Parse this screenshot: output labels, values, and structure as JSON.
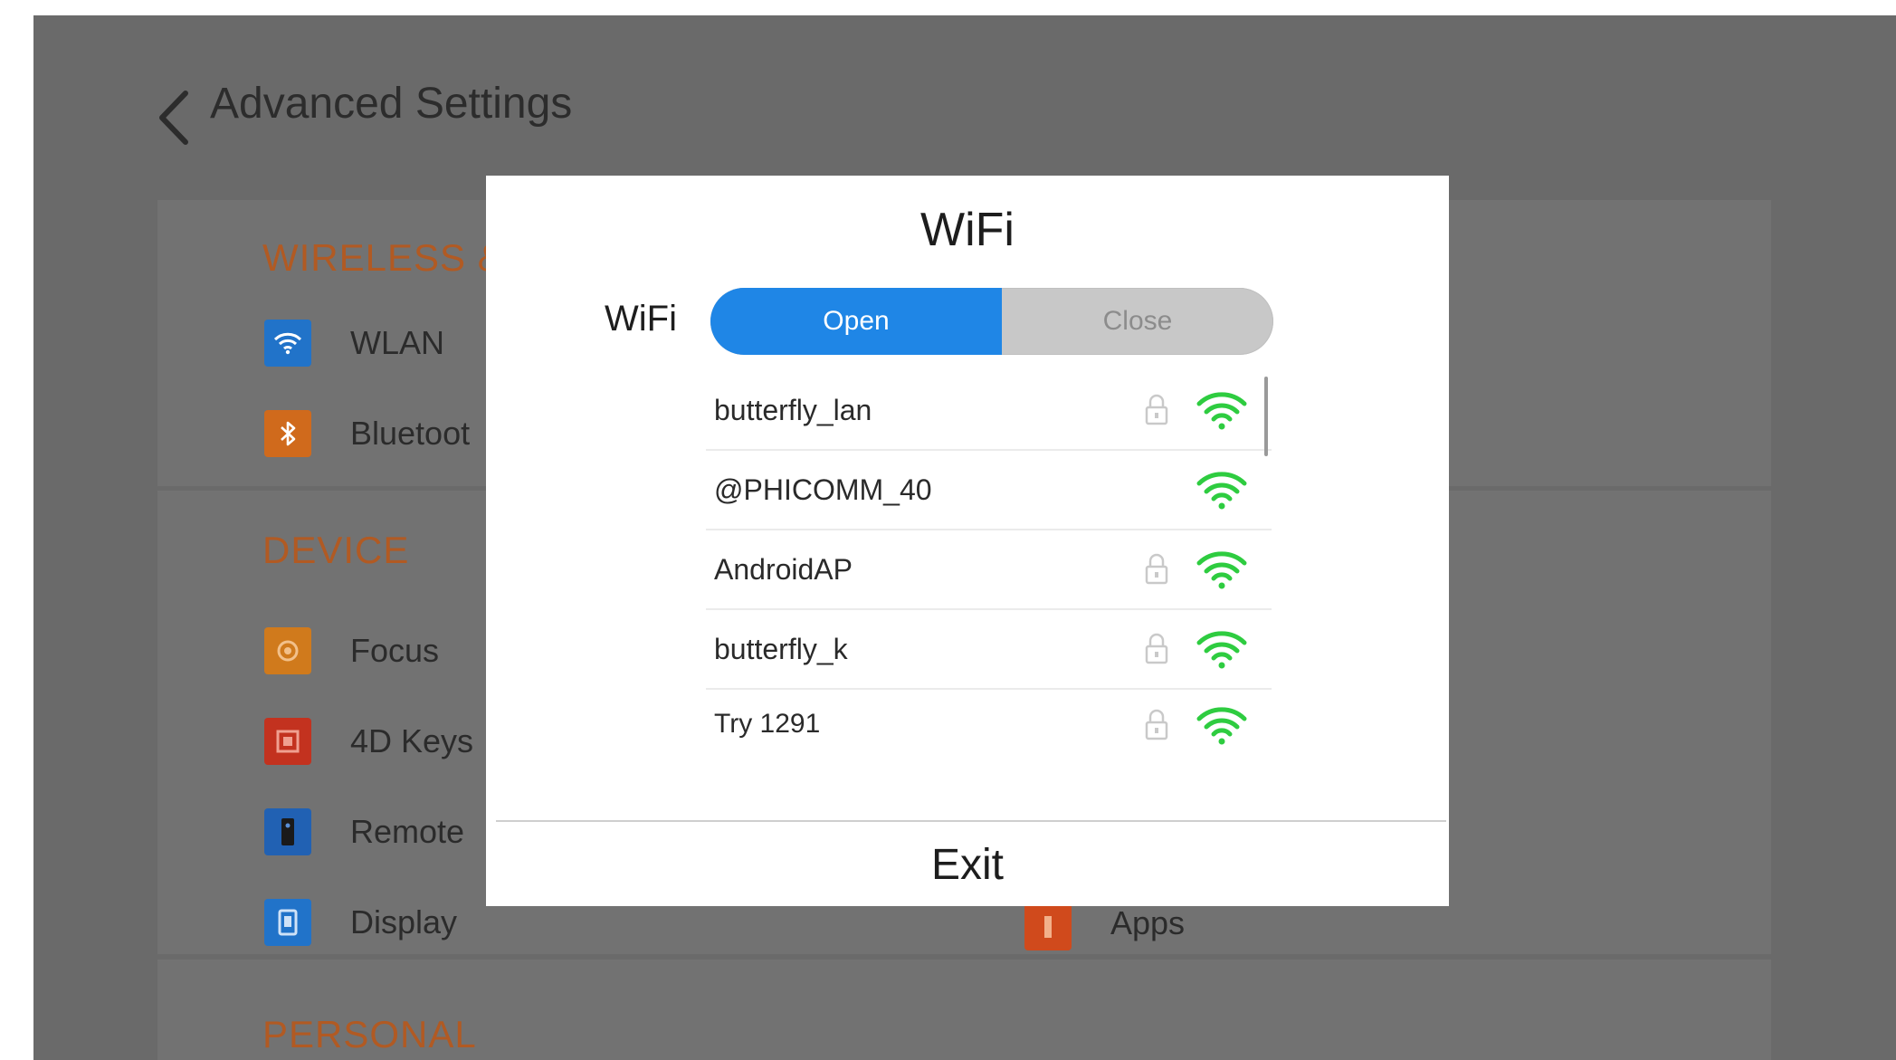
{
  "header": {
    "title": "Advanced Settings"
  },
  "sections": {
    "wireless": {
      "title": "WIRELESS &",
      "items": [
        {
          "label": "WLAN",
          "icon": "wifi-icon",
          "color": "#2173c9"
        },
        {
          "label": "Bluetoot",
          "icon": "bluetooth-icon",
          "color": "#d06a1c"
        }
      ]
    },
    "device": {
      "title": "DEVICE",
      "items": [
        {
          "label": "Focus",
          "icon": "focus-icon",
          "color": "#d07a1c"
        },
        {
          "label": "4D Keys",
          "icon": "keys-icon",
          "color": "#c3321f"
        },
        {
          "label": "Remote",
          "icon": "remote-icon",
          "color": "#2161b3"
        },
        {
          "label": "Display",
          "icon": "display-icon",
          "color": "#2173c9"
        }
      ],
      "right_items": [
        {
          "label": "Apps",
          "icon": "apps-icon",
          "color": "#d04a1c"
        }
      ]
    },
    "personal": {
      "title": "PERSONAL"
    }
  },
  "dialog": {
    "title": "WiFi",
    "switch_label": "WiFi",
    "toggle": {
      "on_label": "Open",
      "off_label": "Close",
      "selected": "Open"
    },
    "networks": [
      {
        "name": "butterfly_lan",
        "locked": true
      },
      {
        "name": "@PHICOMM_40",
        "locked": false
      },
      {
        "name": "AndroidAP",
        "locked": true
      },
      {
        "name": "butterfly_k",
        "locked": true
      },
      {
        "name": "Try 1291",
        "locked": true
      }
    ],
    "exit_label": "Exit"
  },
  "colors": {
    "accent": "#1f86e6",
    "section_title": "#b15a23",
    "signal": "#2ecc40",
    "backdrop": "#6a6a6a"
  }
}
